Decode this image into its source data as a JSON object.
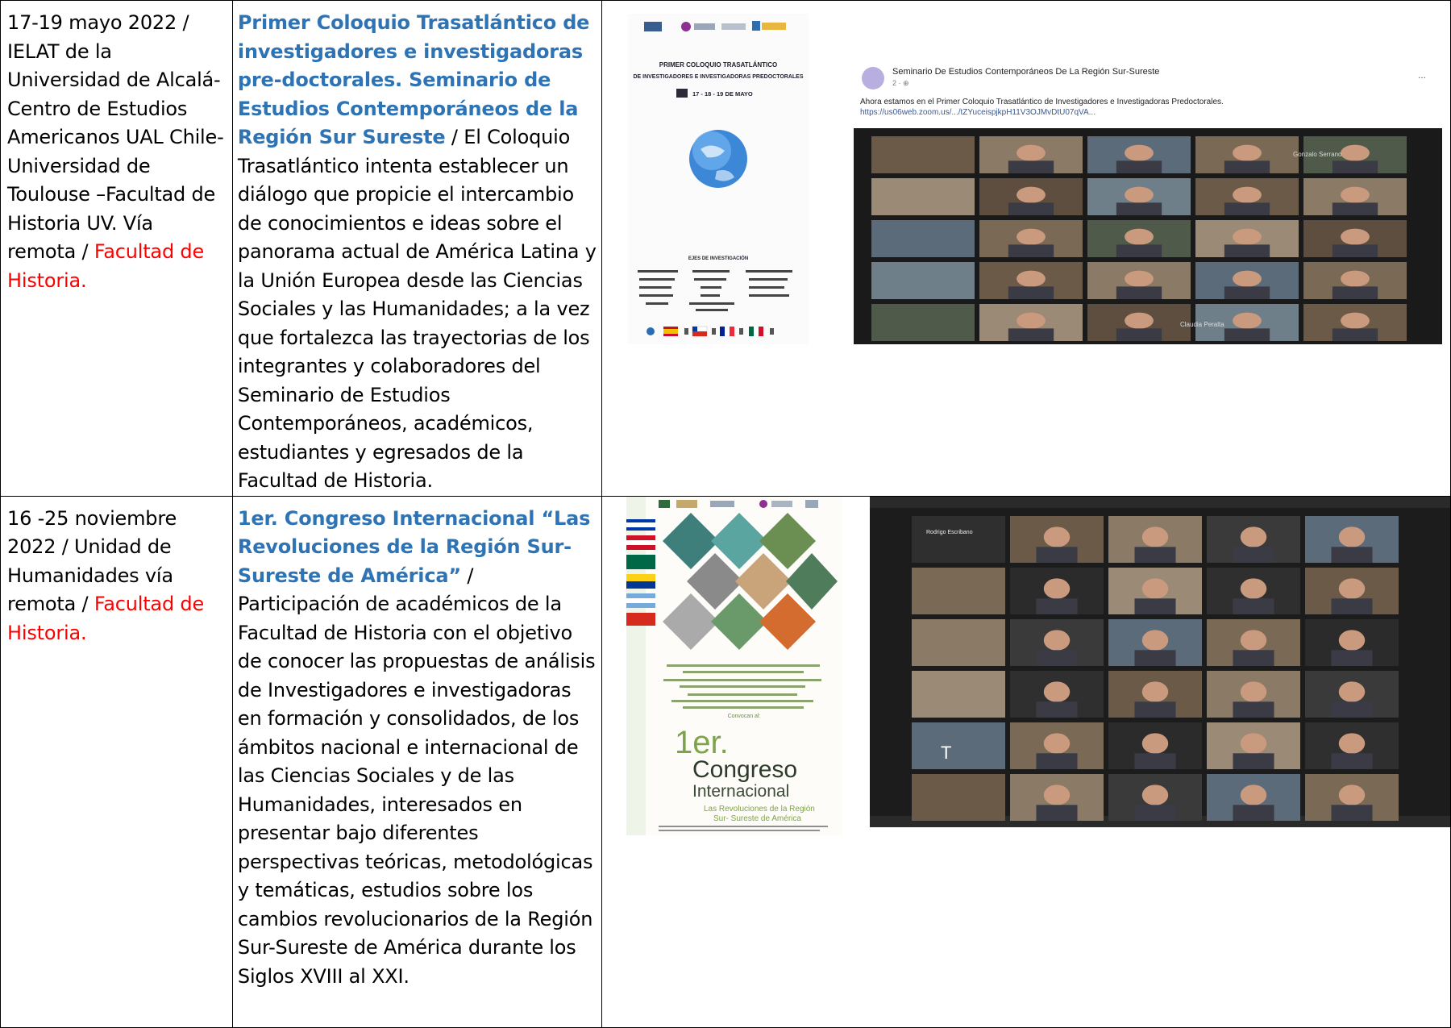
{
  "rows": [
    {
      "date": "17-19 mayo 2022 /",
      "place": "IELAT de la Universidad de Alcalá-Centro de Estudios Americanos UAL Chile-Universidad de Toulouse –Facultad de Historia UV. Vía remota / ",
      "organizer": "Facultad de Historia.",
      "title": "Primer Coloquio Trasatlántico de investigadores e investigadoras pre-doctorales. Seminario de Estudios Contemporáneos de la Región Sur Sureste",
      "description": " / El Coloquio Trasatlántico intenta establecer un diálogo que propicie el intercambio de conocimientos e ideas sobre el panorama actual de América Latina y la Unión Europea desde las Ciencias Sociales y las Humanidades; a la vez que fortalezca las trayectorias de los integrantes y colaboradores del Seminario de Estudios Contemporáneos, académicos, estudiantes y egresados de la Facultad de Historia.",
      "poster": {
        "title_line1": "PRIMER COLOQUIO TRASATLÁNTICO",
        "title_line2": "DE INVESTIGADORES E INVESTIGADORAS PREDOCTORALES",
        "dates": "17 - 18 - 19 DE MAYO",
        "axes_title": "EJES DE INVESTIGACIÓN"
      },
      "post": {
        "page_name": "Seminario De Estudios Contemporáneos De La Región Sur-Sureste",
        "meta": "2 · ⊕",
        "text": "Ahora estamos en el  Primer Coloquio Trasatlántico de Investigadores e Investigadoras Predoctorales.",
        "link": "https://us06web.zoom.us/.../tZYuceispjkpH11V3OJMvDtU07qVA...",
        "more": "...",
        "participants": [
          "Gonzalo Serrano",
          "Claudia Peralta"
        ]
      }
    },
    {
      "date": "16 -25 noviembre 2022 / ",
      "place": "Unidad de Humanidades vía remota / ",
      "organizer": "Facultad de Historia.",
      "title": "1er. Congreso Internacional “Las Revoluciones de la Región Sur-Sureste de América”",
      "description": " / Participación de académicos de la Facultad de Historia con el objetivo de conocer las propuestas de análisis de Investigadores e investigadoras en formación y consolidados, de los ámbitos nacional e internacional de las Ciencias Sociales y de las Humanidades, interesados en presentar bajo diferentes perspectivas teóricas, metodológicas y temáticas, estudios sobre los cambios revolucionarios de la Región Sur-Sureste de América durante los Siglos XVIII al XXI.",
      "poster": {
        "convocan": "Convocan al:",
        "big1": "1er.",
        "big2": "Congreso",
        "big3": "Internacional",
        "sub1": "Las Revoluciones de la Región",
        "sub2": "Sur- Sureste de América"
      },
      "meeting": {
        "tile_labels": [
          "Rodrigo Escribano",
          "",
          "",
          "",
          "",
          "",
          "",
          "",
          "",
          "",
          "",
          "",
          "",
          "",
          "",
          "",
          "",
          "",
          "",
          ""
        ],
        "initial": "T"
      }
    }
  ]
}
